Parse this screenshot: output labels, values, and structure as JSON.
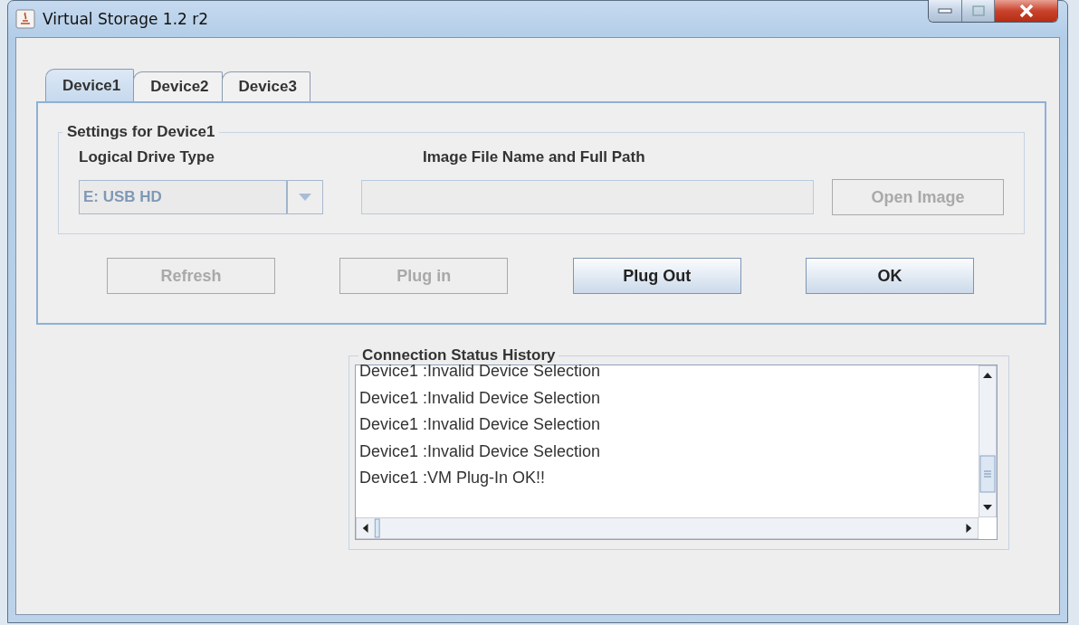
{
  "window": {
    "title": "Virtual Storage 1.2 r2"
  },
  "tabs": [
    {
      "label": "Device1",
      "selected": true
    },
    {
      "label": "Device2",
      "selected": false
    },
    {
      "label": "Device3",
      "selected": false
    }
  ],
  "settings": {
    "title": "Settings for Device1",
    "drive_type": {
      "label": "Logical Drive Type",
      "value": "E: USB HD",
      "disabled": true
    },
    "image_path": {
      "label": "Image File Name and Full Path",
      "disabled": true
    },
    "open_button": {
      "label": "Open Image",
      "disabled": true
    }
  },
  "buttons": [
    {
      "label": "Refresh",
      "disabled": true
    },
    {
      "label": "Plug in",
      "disabled": true
    },
    {
      "label": "Plug Out",
      "disabled": false
    },
    {
      "label": "OK",
      "disabled": false
    }
  ],
  "history": {
    "title": "Connection Status History",
    "lines": [
      "Device1 :Invalid Device Selection",
      "Device1 :Invalid Device Selection",
      "Device1 :Invalid Device Selection",
      "Device1 :Invalid Device Selection",
      "Device1 :VM Plug-In OK!!"
    ]
  }
}
